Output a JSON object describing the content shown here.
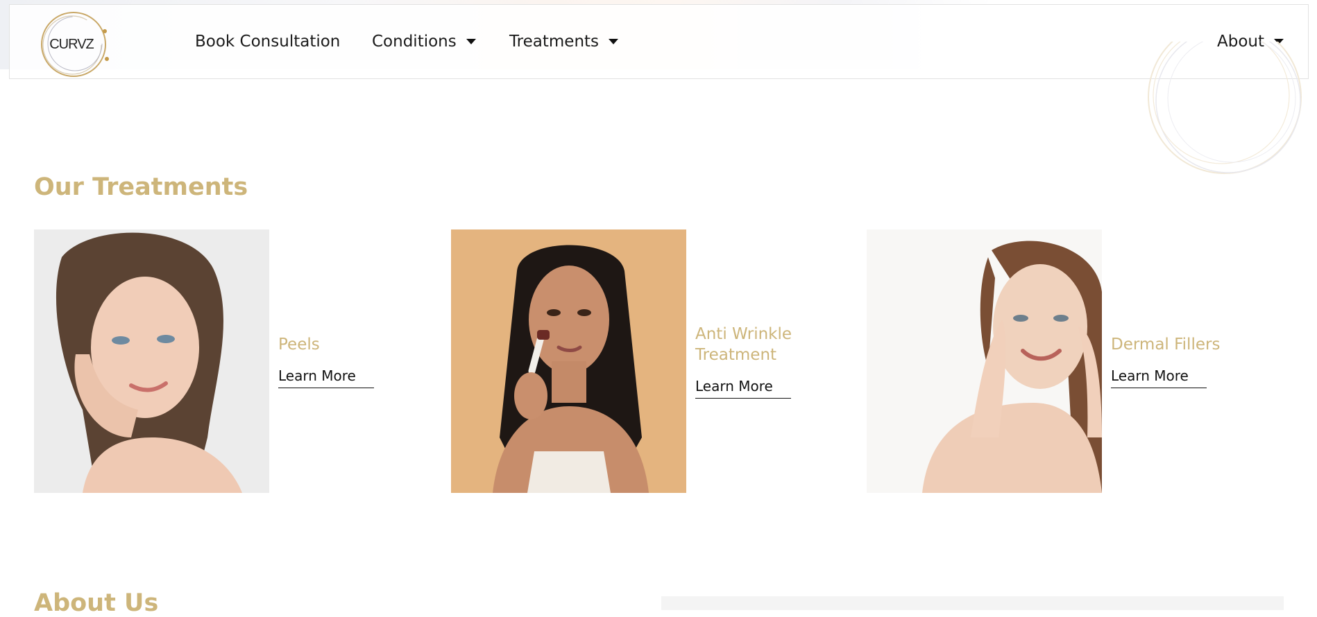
{
  "header": {
    "logo_text": "CURVZ",
    "nav": [
      {
        "label": "Book Consultation",
        "dropdown": false
      },
      {
        "label": "Conditions",
        "dropdown": true
      },
      {
        "label": "Treatments",
        "dropdown": true
      }
    ],
    "about": {
      "label": "About",
      "dropdown": true
    }
  },
  "treatments": {
    "title": "Our Treatments",
    "items": [
      {
        "title": "Peels",
        "link": "Learn More",
        "image_background": "#ececec"
      },
      {
        "title": "Anti Wrinkle Treatment",
        "link": "Learn More",
        "image_background": "#e4b47f"
      },
      {
        "title": "Dermal Fillers",
        "link": "Learn More",
        "image_background": "#f8f7f5"
      }
    ]
  },
  "about_section": {
    "title": "About Us"
  },
  "colors": {
    "accent_gold": "#cdb57a",
    "text_dark": "#1a1a1a",
    "header_border": "#e2e2e2"
  }
}
